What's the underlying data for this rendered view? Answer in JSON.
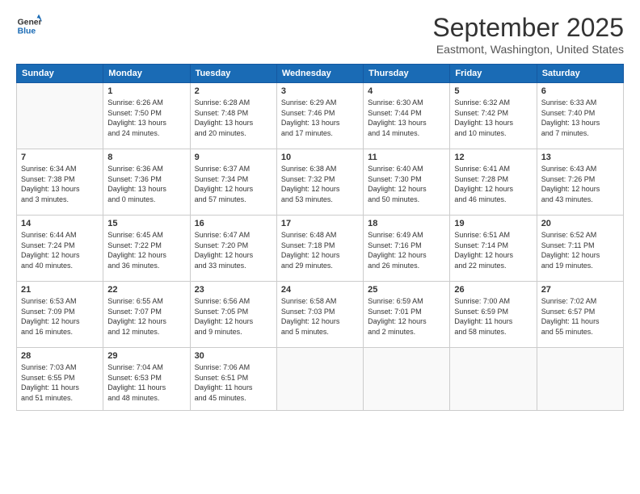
{
  "logo": {
    "line1": "General",
    "line2": "Blue"
  },
  "header": {
    "month": "September 2025",
    "location": "Eastmont, Washington, United States"
  },
  "weekdays": [
    "Sunday",
    "Monday",
    "Tuesday",
    "Wednesday",
    "Thursday",
    "Friday",
    "Saturday"
  ],
  "weeks": [
    [
      {
        "day": "",
        "info": ""
      },
      {
        "day": "1",
        "info": "Sunrise: 6:26 AM\nSunset: 7:50 PM\nDaylight: 13 hours\nand 24 minutes."
      },
      {
        "day": "2",
        "info": "Sunrise: 6:28 AM\nSunset: 7:48 PM\nDaylight: 13 hours\nand 20 minutes."
      },
      {
        "day": "3",
        "info": "Sunrise: 6:29 AM\nSunset: 7:46 PM\nDaylight: 13 hours\nand 17 minutes."
      },
      {
        "day": "4",
        "info": "Sunrise: 6:30 AM\nSunset: 7:44 PM\nDaylight: 13 hours\nand 14 minutes."
      },
      {
        "day": "5",
        "info": "Sunrise: 6:32 AM\nSunset: 7:42 PM\nDaylight: 13 hours\nand 10 minutes."
      },
      {
        "day": "6",
        "info": "Sunrise: 6:33 AM\nSunset: 7:40 PM\nDaylight: 13 hours\nand 7 minutes."
      }
    ],
    [
      {
        "day": "7",
        "info": "Sunrise: 6:34 AM\nSunset: 7:38 PM\nDaylight: 13 hours\nand 3 minutes."
      },
      {
        "day": "8",
        "info": "Sunrise: 6:36 AM\nSunset: 7:36 PM\nDaylight: 13 hours\nand 0 minutes."
      },
      {
        "day": "9",
        "info": "Sunrise: 6:37 AM\nSunset: 7:34 PM\nDaylight: 12 hours\nand 57 minutes."
      },
      {
        "day": "10",
        "info": "Sunrise: 6:38 AM\nSunset: 7:32 PM\nDaylight: 12 hours\nand 53 minutes."
      },
      {
        "day": "11",
        "info": "Sunrise: 6:40 AM\nSunset: 7:30 PM\nDaylight: 12 hours\nand 50 minutes."
      },
      {
        "day": "12",
        "info": "Sunrise: 6:41 AM\nSunset: 7:28 PM\nDaylight: 12 hours\nand 46 minutes."
      },
      {
        "day": "13",
        "info": "Sunrise: 6:43 AM\nSunset: 7:26 PM\nDaylight: 12 hours\nand 43 minutes."
      }
    ],
    [
      {
        "day": "14",
        "info": "Sunrise: 6:44 AM\nSunset: 7:24 PM\nDaylight: 12 hours\nand 40 minutes."
      },
      {
        "day": "15",
        "info": "Sunrise: 6:45 AM\nSunset: 7:22 PM\nDaylight: 12 hours\nand 36 minutes."
      },
      {
        "day": "16",
        "info": "Sunrise: 6:47 AM\nSunset: 7:20 PM\nDaylight: 12 hours\nand 33 minutes."
      },
      {
        "day": "17",
        "info": "Sunrise: 6:48 AM\nSunset: 7:18 PM\nDaylight: 12 hours\nand 29 minutes."
      },
      {
        "day": "18",
        "info": "Sunrise: 6:49 AM\nSunset: 7:16 PM\nDaylight: 12 hours\nand 26 minutes."
      },
      {
        "day": "19",
        "info": "Sunrise: 6:51 AM\nSunset: 7:14 PM\nDaylight: 12 hours\nand 22 minutes."
      },
      {
        "day": "20",
        "info": "Sunrise: 6:52 AM\nSunset: 7:11 PM\nDaylight: 12 hours\nand 19 minutes."
      }
    ],
    [
      {
        "day": "21",
        "info": "Sunrise: 6:53 AM\nSunset: 7:09 PM\nDaylight: 12 hours\nand 16 minutes."
      },
      {
        "day": "22",
        "info": "Sunrise: 6:55 AM\nSunset: 7:07 PM\nDaylight: 12 hours\nand 12 minutes."
      },
      {
        "day": "23",
        "info": "Sunrise: 6:56 AM\nSunset: 7:05 PM\nDaylight: 12 hours\nand 9 minutes."
      },
      {
        "day": "24",
        "info": "Sunrise: 6:58 AM\nSunset: 7:03 PM\nDaylight: 12 hours\nand 5 minutes."
      },
      {
        "day": "25",
        "info": "Sunrise: 6:59 AM\nSunset: 7:01 PM\nDaylight: 12 hours\nand 2 minutes."
      },
      {
        "day": "26",
        "info": "Sunrise: 7:00 AM\nSunset: 6:59 PM\nDaylight: 11 hours\nand 58 minutes."
      },
      {
        "day": "27",
        "info": "Sunrise: 7:02 AM\nSunset: 6:57 PM\nDaylight: 11 hours\nand 55 minutes."
      }
    ],
    [
      {
        "day": "28",
        "info": "Sunrise: 7:03 AM\nSunset: 6:55 PM\nDaylight: 11 hours\nand 51 minutes."
      },
      {
        "day": "29",
        "info": "Sunrise: 7:04 AM\nSunset: 6:53 PM\nDaylight: 11 hours\nand 48 minutes."
      },
      {
        "day": "30",
        "info": "Sunrise: 7:06 AM\nSunset: 6:51 PM\nDaylight: 11 hours\nand 45 minutes."
      },
      {
        "day": "",
        "info": ""
      },
      {
        "day": "",
        "info": ""
      },
      {
        "day": "",
        "info": ""
      },
      {
        "day": "",
        "info": ""
      }
    ]
  ]
}
